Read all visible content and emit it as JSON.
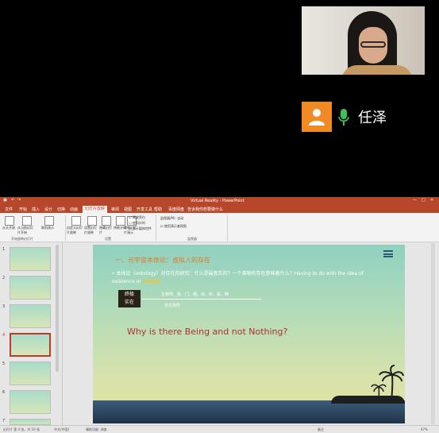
{
  "meeting": {
    "participant_name": "任泽",
    "avatar_color": "#f08a24",
    "mic_color": "#3cc15a"
  },
  "window": {
    "title": "Virtual Reality - PowerPoint",
    "tabs": [
      "文件",
      "开始",
      "插入",
      "设计",
      "切换",
      "动画",
      "幻灯片放映",
      "审阅",
      "视图",
      "开发工具",
      "帮助",
      "百度网盘",
      "告诉我你想要做什么"
    ],
    "active_tab_index": 6,
    "accent": "#b7472a"
  },
  "ribbon": {
    "buttons": [
      "从头开始",
      "从当前幻灯片开始",
      "联机演示",
      "自定义幻灯片放映",
      "设置幻灯片放映",
      "隐藏幻灯片",
      "排练计时",
      "录制幻灯片演示"
    ],
    "checkboxes": [
      "播放旁白",
      "使用计时",
      "显示媒体控件"
    ],
    "monitor_label": "监视器(M): 自动",
    "presenter_view": "使用演示者视图",
    "groups": [
      "开始放映幻灯片",
      "设置",
      "监视器"
    ]
  },
  "thumbnails": {
    "numbers": [
      "1",
      "2",
      "3",
      "4",
      "5",
      "6",
      "7"
    ],
    "selected_index": 3
  },
  "slide": {
    "heading": "一、元宇宙本体论：虚拟人的存在",
    "bullet_text": "• 本体论（ontology）对存在的研究：什么是最真实的？一个事物的存在意味着什么？Having to do with the idea of existence or ",
    "bullet_highlight": "reality",
    "box_text": "终极\n实在",
    "terms": "生物界、我、门、纲、目、科、属、种",
    "note": "非生物界",
    "question": "Why is there Being and not Nothing?"
  },
  "statusbar": {
    "left": "幻灯片 第 4 张，共 10 张",
    "lang": "中文(中国)",
    "access": "辅助功能: 调查",
    "notes": "备注",
    "zoom": "67%"
  }
}
